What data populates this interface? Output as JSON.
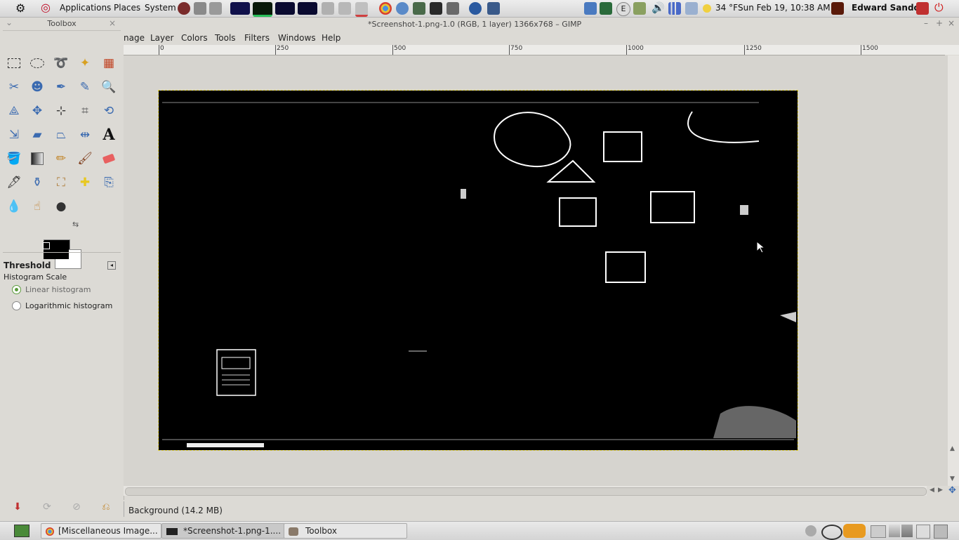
{
  "top_panel": {
    "applications": "Applications",
    "places": "Places",
    "system": "System",
    "weather": "34 °F",
    "clock": "Sun Feb 19, 10:38 AM",
    "user": "Edward Sandor"
  },
  "gimp": {
    "title": "*Screenshot-1.png-1.0 (RGB, 1 layer) 1366x768 – GIMP",
    "menu": [
      "nage",
      "Layer",
      "Colors",
      "Tools",
      "Filters",
      "Windows",
      "Help"
    ],
    "ruler_labels": [
      "0",
      "250",
      "500",
      "750",
      "1000",
      "1250",
      "1500"
    ],
    "status_layer": "Background (14.2 MB)"
  },
  "toolbox": {
    "title": "Toolbox",
    "tool_options_title": "Threshold",
    "histogram_scale_label": "Histogram Scale",
    "linear": "Linear histogram",
    "logarithmic": "Logarithmic histogram",
    "selected_scale": "Linear histogram",
    "fg_color": "#000000",
    "bg_color": "#ffffff"
  },
  "taskbar": {
    "items": [
      "[Miscellaneous Image...",
      "*Screenshot-1.png-1....",
      "Toolbox"
    ]
  }
}
